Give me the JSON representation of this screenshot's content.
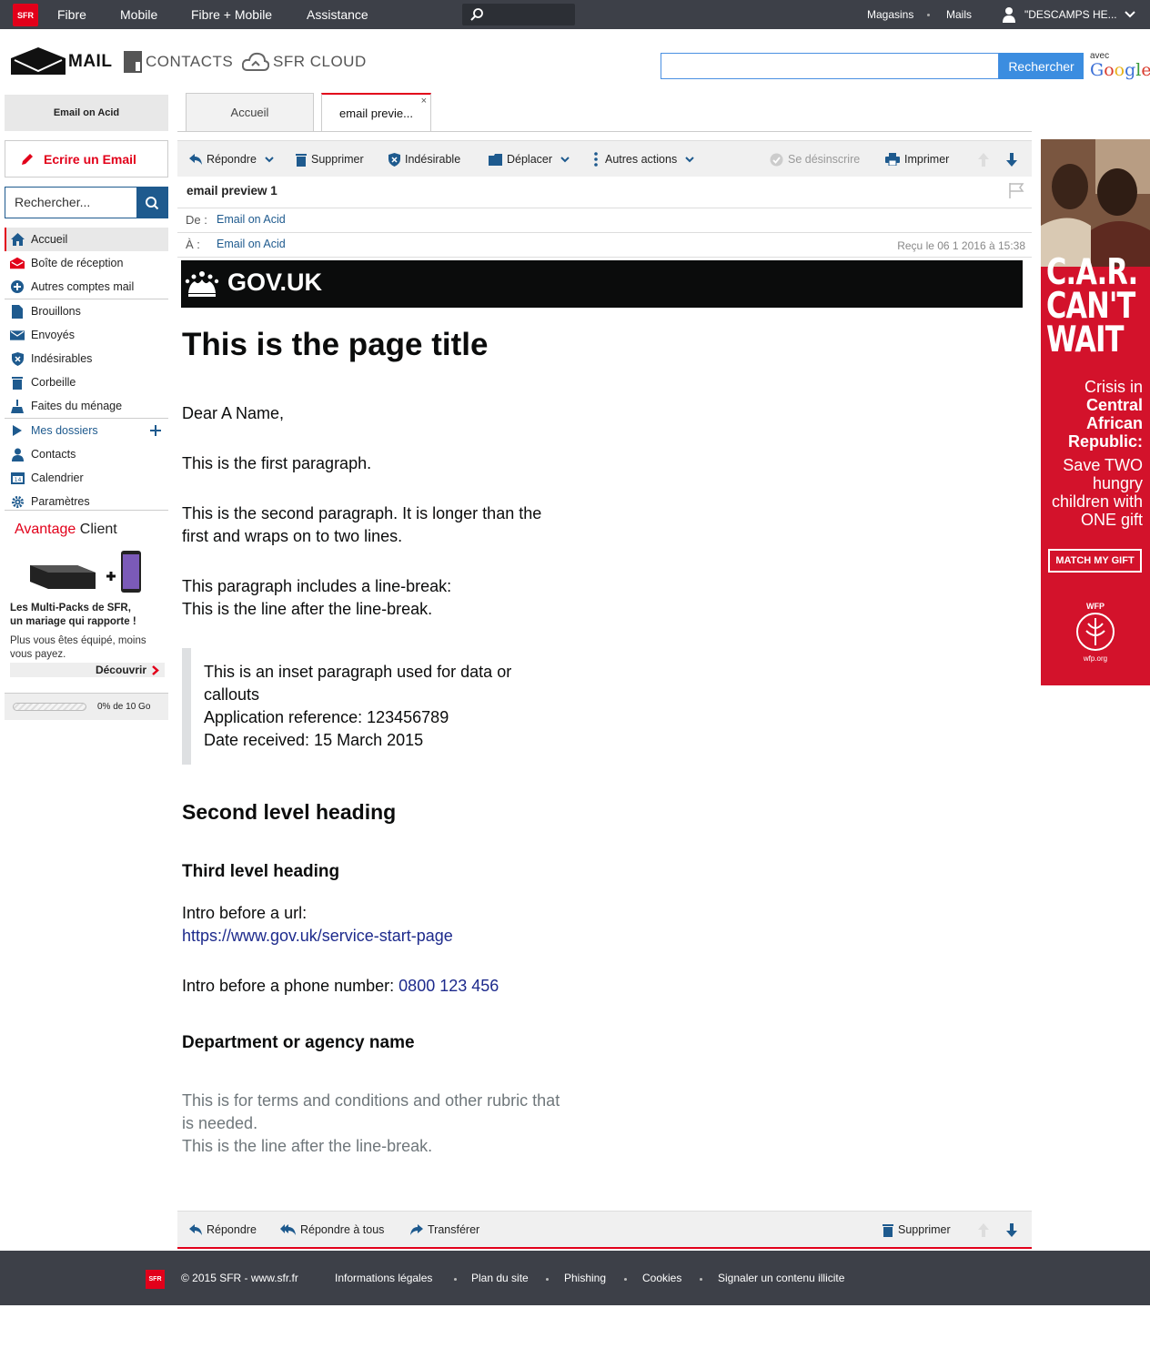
{
  "topbar": {
    "logo": "SFR",
    "nav": [
      "Fibre",
      "Mobile",
      "Fibre + Mobile",
      "Assistance"
    ],
    "stores": "Magasins",
    "mails": "Mails",
    "user": "\"DESCAMPS HE..."
  },
  "header": {
    "mail": "MAIL",
    "contacts": "CONTACTS",
    "cloud": "SFR CLOUD",
    "search_button": "Rechercher",
    "google_avec": "avec",
    "google": "Google"
  },
  "sidebar": {
    "account": "Email on Acid",
    "compose": "Ecrire un Email",
    "search_placeholder": "Rechercher...",
    "items": [
      {
        "label": "Accueil",
        "icon": "home-icon"
      },
      {
        "label": "Boîte de réception",
        "icon": "inbox-icon"
      },
      {
        "label": "Autres comptes mail",
        "icon": "plus-circle-icon"
      },
      {
        "label": "Brouillons",
        "icon": "draft-icon"
      },
      {
        "label": "Envoyés",
        "icon": "sent-icon"
      },
      {
        "label": "Indésirables",
        "icon": "spam-shield-icon"
      },
      {
        "label": "Corbeille",
        "icon": "trash-icon"
      },
      {
        "label": "Faites du ménage",
        "icon": "broom-icon"
      },
      {
        "label": "Mes dossiers",
        "icon": "folder-arrow-icon"
      },
      {
        "label": "Contacts",
        "icon": "contact-icon"
      },
      {
        "label": "Calendrier",
        "icon": "calendar-icon"
      },
      {
        "label": "Paramètres",
        "icon": "gear-icon"
      }
    ],
    "promo": {
      "title_red": "Avantage",
      "title_black": "Client",
      "headline_1": "Les Multi-Packs de SFR,",
      "headline_2": "un mariage qui rapporte !",
      "sub_1": "Plus vous êtes équipé, moins",
      "sub_2": "vous payez.",
      "more": "Découvrir"
    },
    "storage": "0% de 10 Go",
    "storage_used_fraction": 0
  },
  "tabs": [
    {
      "label": "Accueil"
    },
    {
      "label": "email previe...",
      "close": "×"
    }
  ],
  "toolbar": {
    "reply": "Répondre",
    "delete": "Supprimer",
    "spam": "Indésirable",
    "move": "Déplacer",
    "more": "Autres actions",
    "unsubscribe": "Se désinscrire",
    "print": "Imprimer"
  },
  "message": {
    "subject": "email preview 1",
    "from_label": "De :",
    "from": "Email on Acid",
    "to_label": "À :",
    "to": "Email on Acid",
    "received": "Reçu le 06 1 2016 à 15:38"
  },
  "email": {
    "brand": "GOV.UK",
    "title": "This is the page title",
    "greeting": "Dear A Name,",
    "p1": "This is the first paragraph.",
    "p2_l1": "This is the second paragraph. It is longer than the",
    "p2_l2": "first and wraps on to two lines.",
    "p3_l1": "This paragraph includes a line-break:",
    "p3_l2": "This is the line after the line-break.",
    "inset_l1": "This is an inset paragraph used for data or",
    "inset_l2": "callouts",
    "inset_l3": "Application reference: 123456789",
    "inset_l4": "Date received: 15 March 2015",
    "h2": "Second level heading",
    "h3": "Third level heading",
    "url_intro": "Intro before a url:",
    "url": "https://www.gov.uk/service-start-page",
    "phone_intro": "Intro before a phone number:",
    "phone": "0800 123 456",
    "dept": "Department or agency name",
    "terms_l1": "This is for terms and conditions and other rubric that",
    "terms_l2": "is needed.",
    "terms_l3": "This is the line after the line-break."
  },
  "bottom_toolbar": {
    "reply": "Répondre",
    "reply_all": "Répondre à tous",
    "forward": "Transférer",
    "delete": "Supprimer"
  },
  "ad": {
    "line1": "C.A.R.",
    "line2": "CAN'T",
    "line3": "WAIT",
    "crisis_1": "Crisis in",
    "crisis_2": "Central",
    "crisis_3": "African",
    "crisis_4": "Republic:",
    "save_1": "Save TWO",
    "save_2": "hungry",
    "save_3": "children with",
    "save_4": "ONE gift",
    "button": "MATCH MY GIFT",
    "wfp": "WFP",
    "wfp_url": "wfp.org"
  },
  "footer": {
    "logo": "SFR",
    "copyright": "© 2015 SFR - www.sfr.fr",
    "links": [
      "Informations légales",
      "Plan du site",
      "Phishing",
      "Cookies",
      "Signaler un contenu illicite"
    ]
  }
}
